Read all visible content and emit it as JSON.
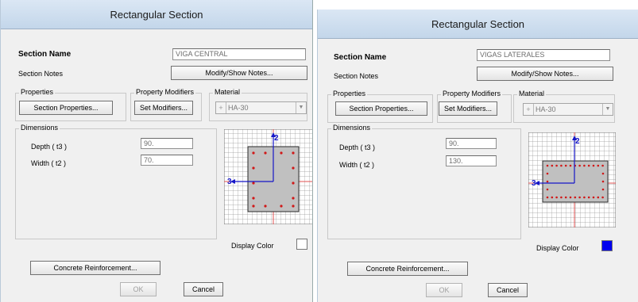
{
  "left": {
    "title": "Rectangular Section",
    "section_name_label": "Section Name",
    "section_name_value": "VIGA CENTRAL",
    "section_notes_label": "Section Notes",
    "modify_notes_button": "Modify/Show Notes...",
    "properties_group": "Properties",
    "section_properties_button": "Section Properties...",
    "property_modifiers_group": "Property Modifiers",
    "set_modifiers_button": "Set Modifiers...",
    "material_group": "Material",
    "material_plus": "+",
    "material_value": "HA-30",
    "dimensions_group": "Dimensions",
    "depth_label": "Depth  ( t3 )",
    "depth_value": "90.",
    "width_label": "Width  ( t2 )",
    "width_value": "70.",
    "axis_2": "2",
    "axis_3": "3",
    "display_color_label": "Display Color",
    "display_color": "#ffffff",
    "concrete_reinforcement_button": "Concrete Reinforcement...",
    "ok_button": "OK",
    "cancel_button": "Cancel"
  },
  "right": {
    "title": "Rectangular Section",
    "section_name_label": "Section Name",
    "section_name_value": "VIGAS LATERALES",
    "section_notes_label": "Section Notes",
    "modify_notes_button": "Modify/Show Notes...",
    "properties_group": "Properties",
    "section_properties_button": "Section Properties...",
    "property_modifiers_group": "Property Modifiers",
    "set_modifiers_button": "Set Modifiers...",
    "material_group": "Material",
    "material_plus": "+",
    "material_value": "HA-30",
    "dimensions_group": "Dimensions",
    "depth_label": "Depth  ( t3 )",
    "depth_value": "90.",
    "width_label": "Width  ( t2 )",
    "width_value": "130.",
    "axis_2": "2",
    "axis_3": "3",
    "display_color_label": "Display Color",
    "display_color": "#0000ee",
    "concrete_reinforcement_button": "Concrete Reinforcement...",
    "ok_button": "OK",
    "cancel_button": "Cancel"
  }
}
